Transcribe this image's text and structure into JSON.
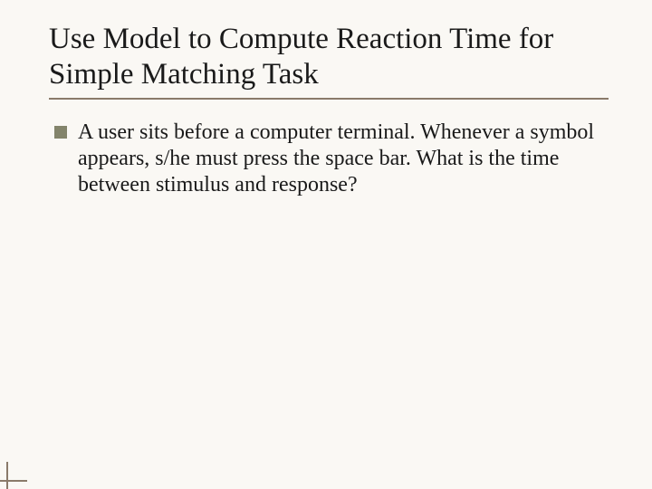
{
  "title": "Use Model to Compute Reaction Time for Simple Matching Task",
  "bullets": [
    {
      "text": "A user sits before a computer terminal. Whenever a symbol appears, s/he must press the space bar. What is the time between stimulus and response?"
    }
  ]
}
